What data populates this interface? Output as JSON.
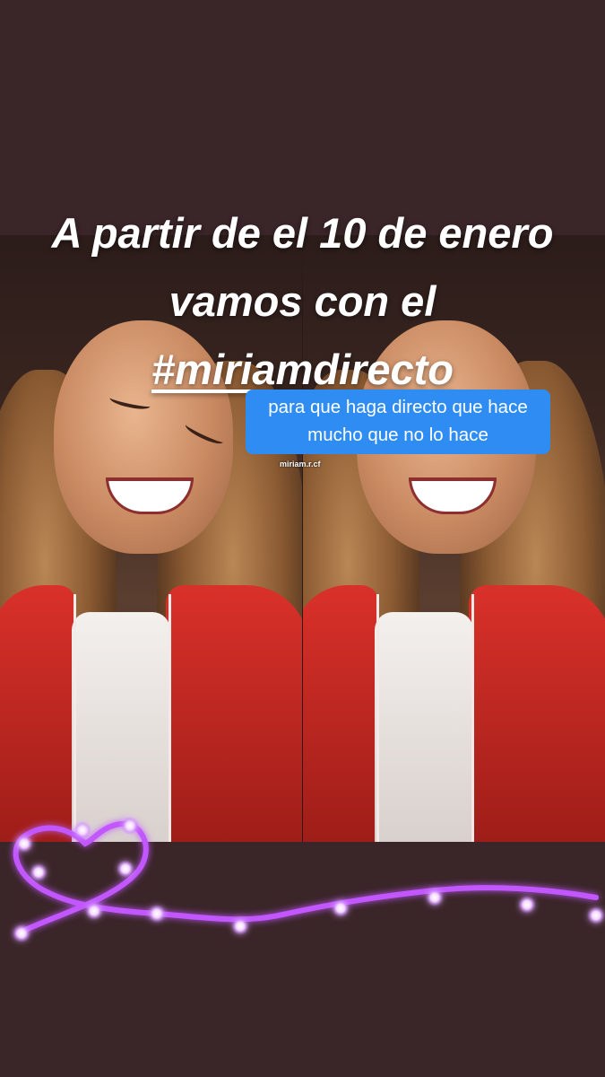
{
  "story": {
    "headline_part1": "A partir de el 10 de enero vamos con el ",
    "headline_hashtag": "#miriamdirecto",
    "caption": "para que haga directo que hace mucho que no lo hace",
    "username": "miriam.r.cf"
  },
  "colors": {
    "background": "#3a2528",
    "caption_bg": "#2f8cf2",
    "lights_glow": "#b040ff"
  },
  "icons": {
    "sticker": "heart-string-lights-icon"
  }
}
